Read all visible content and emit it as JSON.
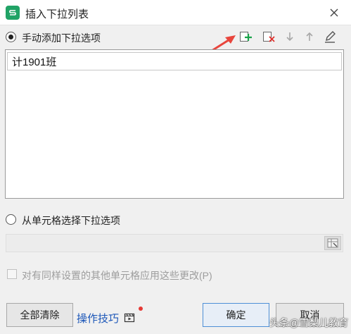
{
  "window": {
    "title": "插入下拉列表",
    "app_icon_letter": "S",
    "close_icon": "close-icon"
  },
  "manual": {
    "label": "手动添加下拉选项",
    "selected": true
  },
  "toolbar": {
    "icons": [
      "add-item-icon",
      "delete-item-icon",
      "move-down-icon",
      "move-up-icon",
      "edit-icon"
    ]
  },
  "list": {
    "editing_value": "计1901班"
  },
  "cell_source": {
    "label": "从单元格选择下拉选项",
    "selected": false,
    "range_value": ""
  },
  "apply_same": {
    "label": "对有同样设置的其他单元格应用这些更改(P)",
    "checked": false
  },
  "buttons": {
    "clear_all": "全部清除",
    "tips": "操作技巧",
    "ok": "确定",
    "cancel": "取消"
  },
  "watermark": "头条@雪梨儿教育",
  "colors": {
    "app_green": "#21a366",
    "add_green": "#1aa34a",
    "delete_red": "#e0322e",
    "annotation_red": "#e8453c",
    "link_blue": "#1b56b8"
  }
}
